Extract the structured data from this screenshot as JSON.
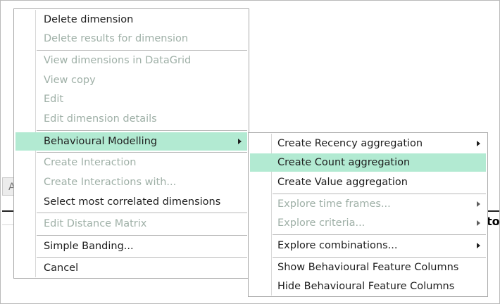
{
  "background": {
    "tab_label": "A",
    "column_header_fragment": "to"
  },
  "context_menu": {
    "items": [
      {
        "label": "Delete dimension",
        "enabled": true
      },
      {
        "label": "Delete results for dimension",
        "enabled": false
      },
      {
        "label": "View dimensions in DataGrid",
        "enabled": false
      },
      {
        "label": "View copy",
        "enabled": false
      },
      {
        "label": "Edit",
        "enabled": false
      },
      {
        "label": "Edit dimension details",
        "enabled": false
      },
      {
        "label": "Behavioural Modelling",
        "enabled": true,
        "highlighted": true,
        "submenu": true
      },
      {
        "label": "Create Interaction",
        "enabled": false
      },
      {
        "label": "Create Interactions with...",
        "enabled": false
      },
      {
        "label": "Select most correlated dimensions",
        "enabled": true
      },
      {
        "label": "Edit Distance Matrix",
        "enabled": false
      },
      {
        "label": "Simple Banding...",
        "enabled": true
      },
      {
        "label": "Cancel",
        "enabled": true
      }
    ]
  },
  "submenu": {
    "items": [
      {
        "label": "Create Recency aggregation",
        "enabled": true,
        "submenu": true
      },
      {
        "label": "Create Count aggregation",
        "enabled": true,
        "highlighted": true
      },
      {
        "label": "Create Value aggregation",
        "enabled": true
      },
      {
        "label": "Explore time frames...",
        "enabled": false,
        "submenu": true
      },
      {
        "label": "Explore criteria...",
        "enabled": false,
        "submenu": true
      },
      {
        "label": "Explore combinations...",
        "enabled": true,
        "submenu": true
      },
      {
        "label": "Show Behavioural Feature Columns",
        "enabled": true
      },
      {
        "label": "Hide Behavioural Feature Columns",
        "enabled": true
      }
    ]
  },
  "colors": {
    "highlight": "#b2ead2",
    "disabled_text": "#9fb0a7",
    "text": "#1e1e1e",
    "border": "#a9a9a9"
  }
}
